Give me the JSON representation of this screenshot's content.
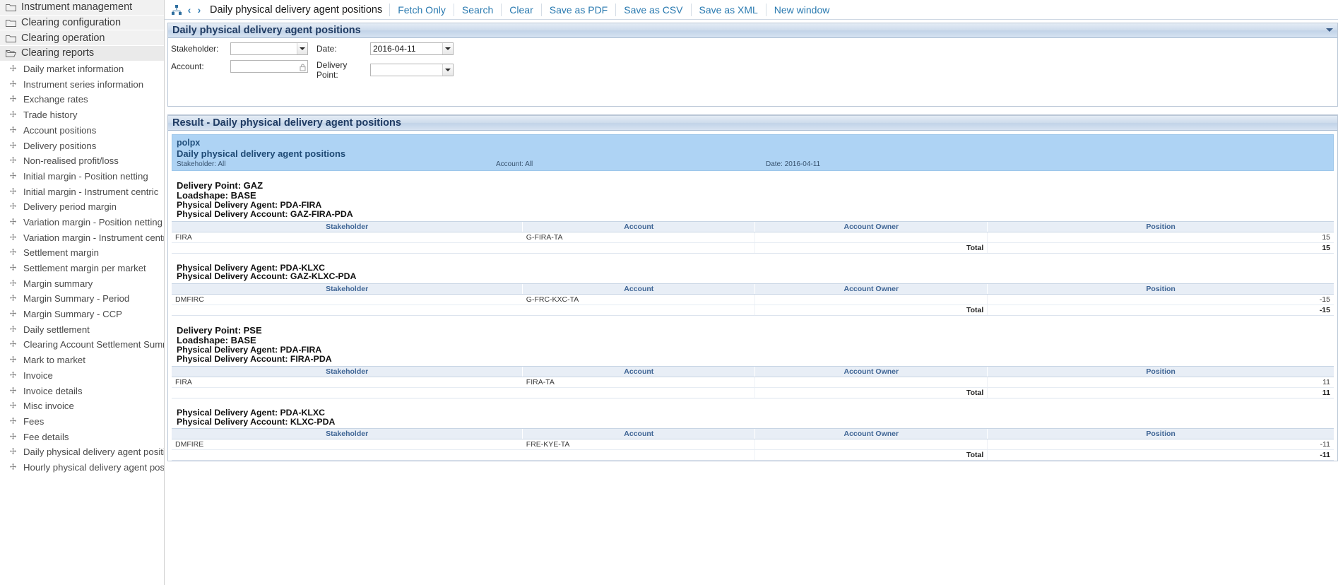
{
  "sidebar": {
    "folders": [
      {
        "label": "Instrument management",
        "icon": "folder-closed-icon",
        "active": false
      },
      {
        "label": "Clearing configuration",
        "icon": "folder-closed-icon",
        "active": false
      },
      {
        "label": "Clearing operation",
        "icon": "folder-closed-icon",
        "active": false
      },
      {
        "label": "Clearing reports",
        "icon": "folder-open-icon",
        "active": true
      }
    ],
    "items": [
      {
        "label": "Daily market information"
      },
      {
        "label": "Instrument series information"
      },
      {
        "label": "Exchange rates"
      },
      {
        "label": "Trade history"
      },
      {
        "label": "Account positions"
      },
      {
        "label": "Delivery positions"
      },
      {
        "label": "Non-realised profit/loss"
      },
      {
        "label": "Initial margin - Position netting"
      },
      {
        "label": "Initial margin - Instrument centric"
      },
      {
        "label": "Delivery period margin"
      },
      {
        "label": "Variation margin - Position netting"
      },
      {
        "label": "Variation margin - Instrument centric"
      },
      {
        "label": "Settlement margin"
      },
      {
        "label": "Settlement margin per market"
      },
      {
        "label": "Margin summary"
      },
      {
        "label": "Margin Summary - Period"
      },
      {
        "label": "Margin Summary - CCP"
      },
      {
        "label": "Daily settlement"
      },
      {
        "label": "Clearing Account Settlement Summary"
      },
      {
        "label": "Mark to market"
      },
      {
        "label": "Invoice"
      },
      {
        "label": "Invoice details"
      },
      {
        "label": "Misc invoice"
      },
      {
        "label": "Fees"
      },
      {
        "label": "Fee details"
      },
      {
        "label": "Daily physical delivery agent positions"
      },
      {
        "label": "Hourly physical delivery agent positions"
      }
    ]
  },
  "toolbar": {
    "hierarchy_icon": "sitemap-icon",
    "back_icon": "chevron-left-icon",
    "forward_icon": "chevron-right-icon",
    "title": "Daily physical delivery agent positions",
    "links": [
      {
        "label": "Fetch Only"
      },
      {
        "label": "Search"
      },
      {
        "label": "Clear"
      },
      {
        "label": "Save as PDF"
      },
      {
        "label": "Save as CSV"
      },
      {
        "label": "Save as XML"
      },
      {
        "label": "New window"
      }
    ]
  },
  "search_panel": {
    "title": "Daily physical delivery agent positions",
    "collapse_icon": "collapse-icon",
    "fields": {
      "stakeholder_label": "Stakeholder:",
      "stakeholder_value": "",
      "account_label": "Account:",
      "account_value": "",
      "account_lock_icon": "lock-icon",
      "date_label": "Date:",
      "date_value": "2016-04-11",
      "delivery_point_label": "Delivery Point:",
      "delivery_point_value": ""
    }
  },
  "result_panel": {
    "title": "Result - Daily physical delivery agent positions",
    "report_header": {
      "organisation": "polpx",
      "report_name": "Daily physical delivery agent positions",
      "stakeholder": "Stakeholder: All",
      "account": "Account: All",
      "date": "Date: 2016-04-11"
    },
    "columns": [
      "Stakeholder",
      "Account",
      "Account Owner",
      "Position"
    ],
    "total_label": "Total",
    "groups": [
      {
        "delivery_point": "Delivery Point: GAZ",
        "loadshape": "Loadshape: BASE",
        "agent": "Physical Delivery Agent: PDA-FIRA",
        "account": "Physical Delivery Account: GAZ-FIRA-PDA",
        "show_delivery_point": true,
        "rows": [
          {
            "stakeholder": "FIRA",
            "account": "G-FIRA-TA",
            "account_owner": "",
            "position": "15"
          }
        ],
        "total": "15"
      },
      {
        "delivery_point": "",
        "loadshape": "",
        "agent": "Physical Delivery Agent: PDA-KLXC",
        "account": "Physical Delivery Account: GAZ-KLXC-PDA",
        "show_delivery_point": false,
        "rows": [
          {
            "stakeholder": "DMFIRC",
            "account": "G-FRC-KXC-TA",
            "account_owner": "",
            "position": "-15"
          }
        ],
        "total": "-15"
      },
      {
        "delivery_point": "Delivery Point: PSE",
        "loadshape": "Loadshape: BASE",
        "agent": "Physical Delivery Agent: PDA-FIRA",
        "account": "Physical Delivery Account: FIRA-PDA",
        "show_delivery_point": true,
        "rows": [
          {
            "stakeholder": "FIRA",
            "account": "FIRA-TA",
            "account_owner": "",
            "position": "11"
          }
        ],
        "total": "11"
      },
      {
        "delivery_point": "",
        "loadshape": "",
        "agent": "Physical Delivery Agent: PDA-KLXC",
        "account": "Physical Delivery Account: KLXC-PDA",
        "show_delivery_point": false,
        "rows": [
          {
            "stakeholder": "DMFIRE",
            "account": "FRE-KYE-TA",
            "account_owner": "",
            "position": "-11"
          }
        ],
        "total": "-11"
      }
    ]
  },
  "colors": {
    "accent_link": "#2a7ab0",
    "panel_header_text": "#1f3b63",
    "report_band": "#aed3f4",
    "table_header_bg": "#e8eef6",
    "table_header_text": "#3f6595"
  }
}
